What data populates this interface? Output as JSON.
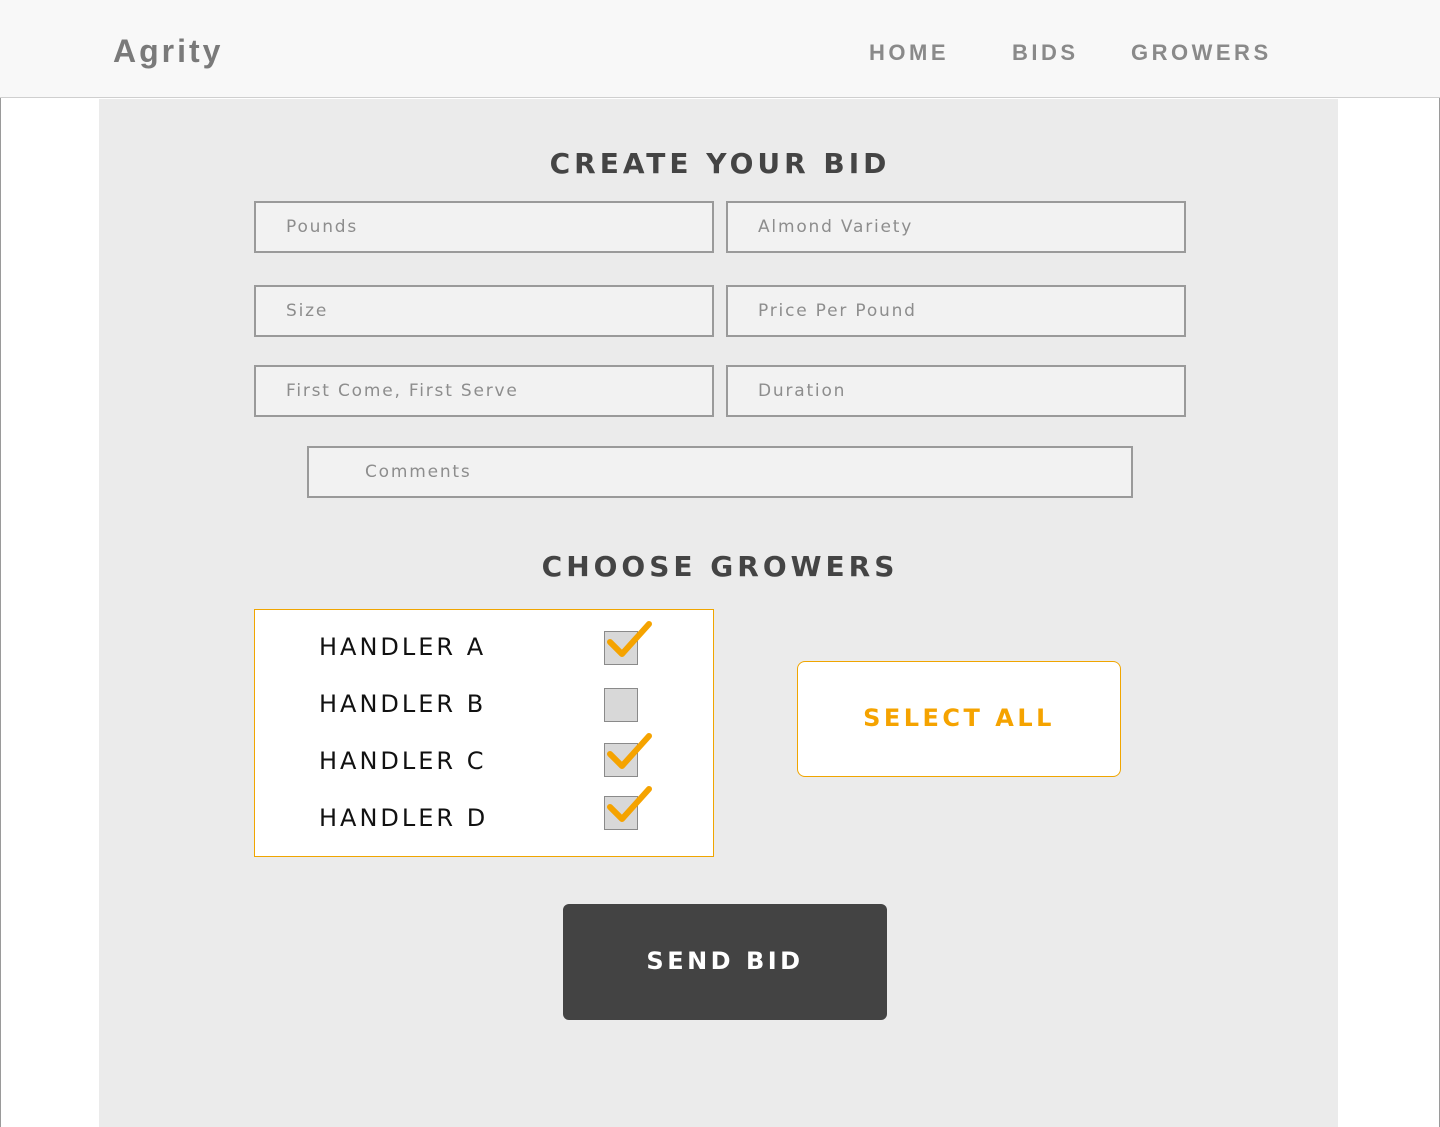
{
  "brand": "Agrity",
  "nav": {
    "home": "HOME",
    "bids": "BIDS",
    "growers": "GROWERS"
  },
  "form": {
    "title": "CREATE YOUR BID",
    "pounds_placeholder": "Pounds",
    "variety_placeholder": "Almond Variety",
    "size_placeholder": "Size",
    "price_placeholder": "Price Per Pound",
    "fcfs_placeholder": "First Come, First Serve",
    "duration_placeholder": "Duration",
    "comments_placeholder": "Comments"
  },
  "growers": {
    "title": "CHOOSE GROWERS",
    "items": [
      {
        "label": "HANDLER A",
        "checked": true
      },
      {
        "label": "HANDLER B",
        "checked": false
      },
      {
        "label": "HANDLER C",
        "checked": true
      },
      {
        "label": "HANDLER D",
        "checked": true
      }
    ],
    "select_all_label": "SELECT ALL"
  },
  "send_label": "SEND BID",
  "colors": {
    "accent": "#f5a300",
    "dark_button": "#434343",
    "panel": "#ebebeb",
    "heading": "#444444"
  }
}
